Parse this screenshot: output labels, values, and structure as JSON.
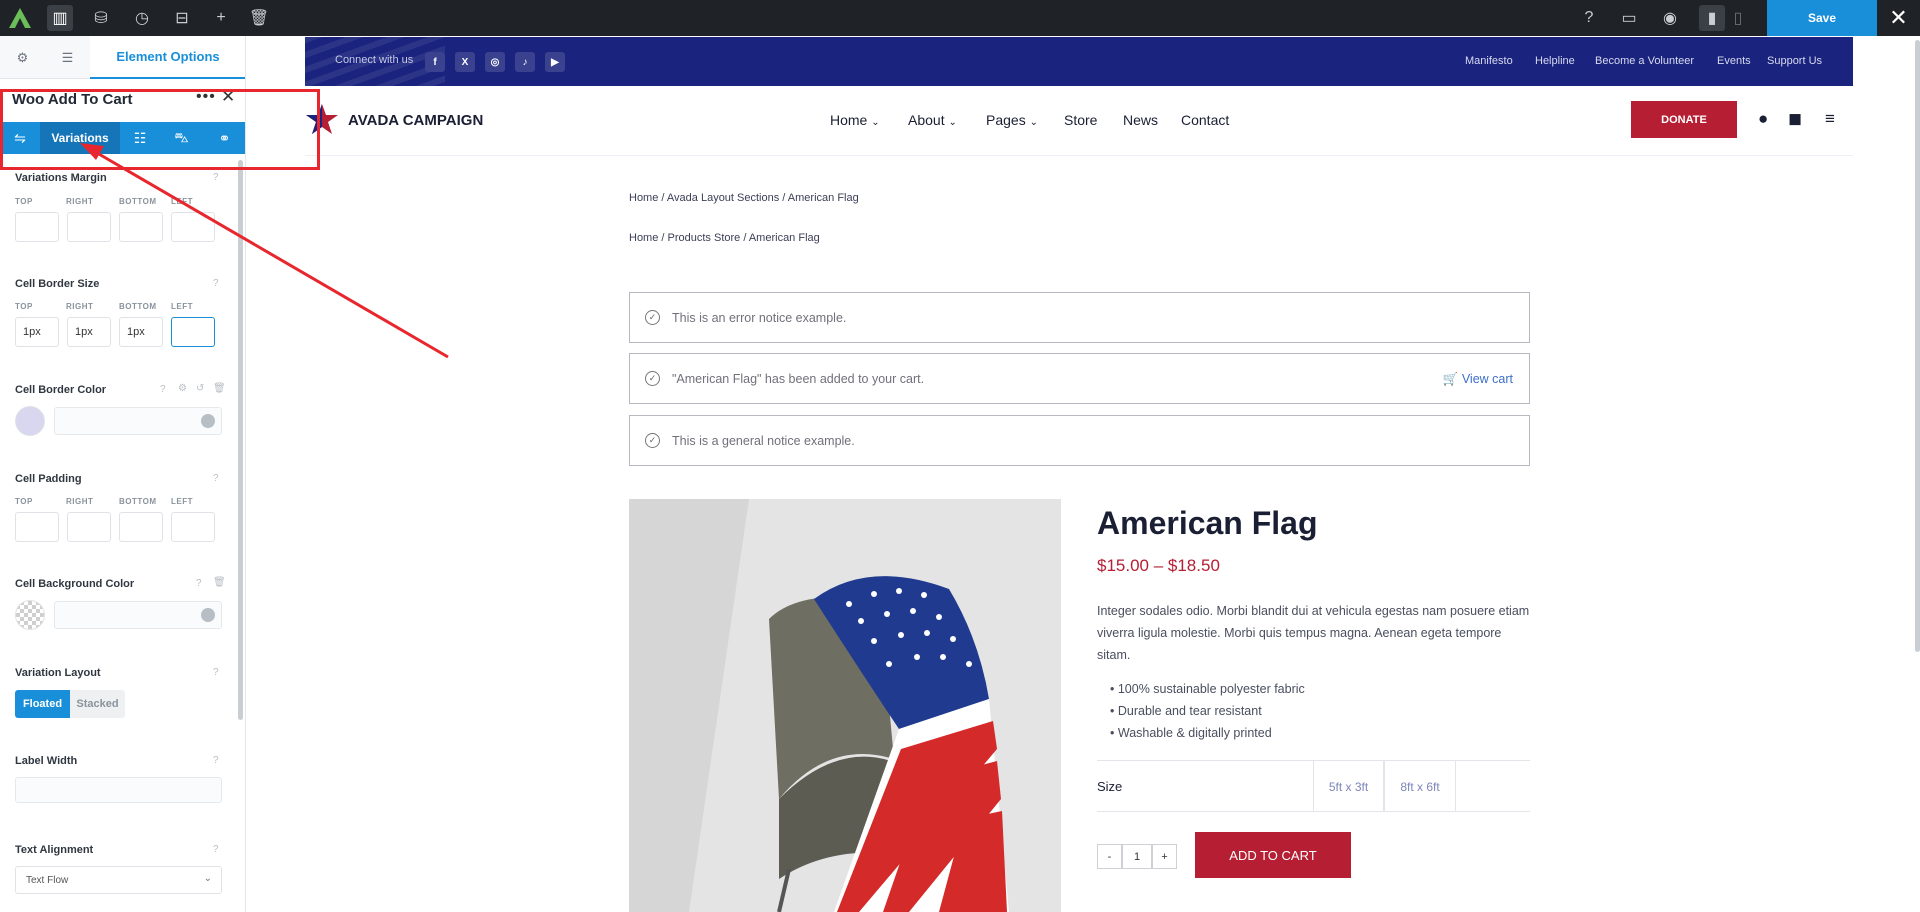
{
  "toolbar": {
    "save_label": "Save",
    "close_label": "✕",
    "icons": [
      "avada-logo-icon",
      "layout-icon",
      "library-icon",
      "history-icon",
      "toggles-icon",
      "add-icon",
      "trash-icon"
    ],
    "right_icons": [
      "help-icon",
      "desktop-icon",
      "preview-icon",
      "page-icon",
      "page-alt-icon"
    ]
  },
  "panel": {
    "tabs": {
      "settings": "⚙",
      "options": "☰",
      "element_options": "Element Options"
    },
    "element_title": "Woo Add To Cart",
    "more": "•••",
    "close": "✕",
    "subtabs": {
      "active_label": "Variations"
    },
    "variations_margin": {
      "label": "Variations Margin",
      "sub": [
        "TOP",
        "RIGHT",
        "BOTTOM",
        "LEFT"
      ]
    },
    "cell_border_size": {
      "label": "Cell Border Size",
      "sub": [
        "TOP",
        "RIGHT",
        "BOTTOM",
        "LEFT"
      ],
      "values": [
        "1px",
        "1px",
        "1px",
        ""
      ]
    },
    "cell_border_color": {
      "label": "Cell Border Color",
      "swatch": "#d9d6ef"
    },
    "cell_padding": {
      "label": "Cell Padding",
      "sub": [
        "TOP",
        "RIGHT",
        "BOTTOM",
        "LEFT"
      ]
    },
    "cell_background_color": {
      "label": "Cell Background Color"
    },
    "variation_layout": {
      "label": "Variation Layout",
      "options": [
        "Floated",
        "Stacked"
      ],
      "selected": "Floated"
    },
    "label_width": {
      "label": "Label Width"
    },
    "text_alignment": {
      "label": "Text Alignment",
      "value": "Text Flow"
    }
  },
  "site": {
    "topbar": {
      "connect": "Connect with us",
      "social": [
        "f",
        "X",
        "◎",
        "♪",
        "▶"
      ],
      "links": [
        "Manifesto",
        "Helpline",
        "Become a Volunteer",
        "Events",
        "Support Us"
      ]
    },
    "header": {
      "logo_text": "AVADA CAMPAIGN",
      "nav": [
        "Home",
        "About",
        "Pages",
        "Store",
        "News",
        "Contact"
      ],
      "donate": "DONATE"
    },
    "breadcrumbs": [
      [
        "Home",
        "Avada Layout Sections",
        "American Flag"
      ],
      [
        "Home",
        "Products Store",
        "American Flag"
      ]
    ],
    "notices": [
      {
        "text": "This is an error notice example."
      },
      {
        "text": "\"American Flag\" has been added to your cart.",
        "link": "View cart"
      },
      {
        "text": "This is a general notice example."
      }
    ],
    "product": {
      "title": "American Flag",
      "price": "$15.00 – $18.50",
      "description": "Integer sodales odio. Morbi blandit dui at vehicula egestas nam posuere etiam viverra ligula molestie. Morbi quis tempus magna. Aenean egeta tempore sitam.",
      "bullets": [
        "100% sustainable polyester fabric",
        "Durable and tear resistant",
        "Washable & digitally printed"
      ],
      "size_label": "Size",
      "sizes": [
        "5ft x 3ft",
        "8ft x 6ft"
      ],
      "qty_minus": "-",
      "qty_value": "1",
      "qty_plus": "+",
      "add_to_cart": "ADD TO CART"
    }
  }
}
